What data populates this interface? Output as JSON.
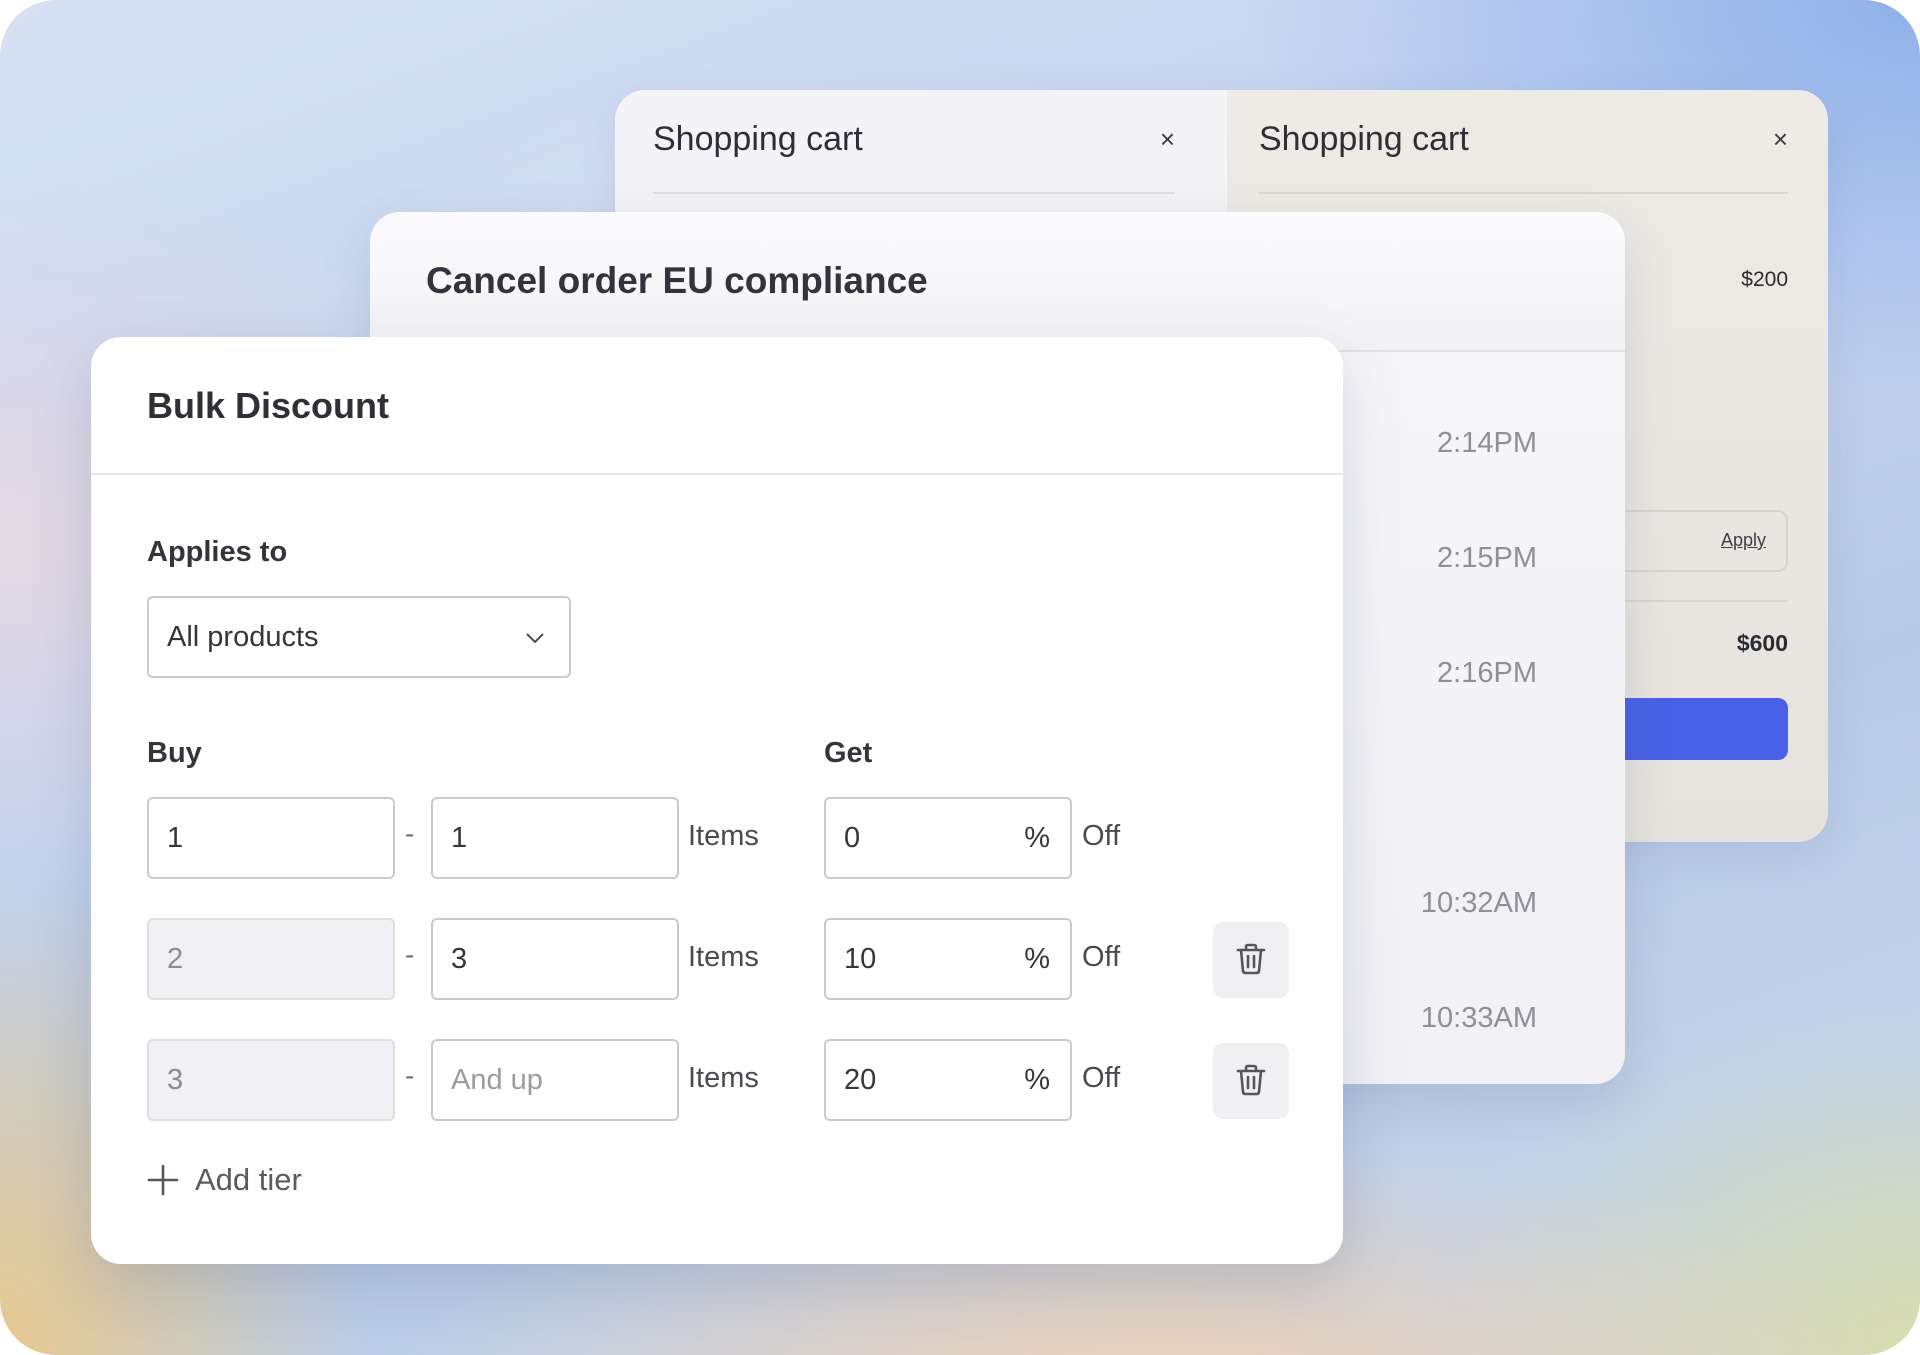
{
  "shopping_cart_left": {
    "title": "Shopping cart",
    "close_glyph": "×"
  },
  "shopping_cart_right": {
    "title": "Shopping cart",
    "close_glyph": "×",
    "line_price": "$200",
    "coupon_apply_label": "Apply",
    "total": "$600",
    "checkout_color": "#4a61e7"
  },
  "cancel_order": {
    "title": "Cancel order EU compliance",
    "timestamps": [
      "2:14PM",
      "2:15PM",
      "2:16PM",
      "10:32AM",
      "10:33AM"
    ]
  },
  "bulk_discount": {
    "title": "Bulk Discount",
    "applies_to_label": "Applies to",
    "applies_to_value": "All products",
    "buy_label": "Buy",
    "get_label": "Get",
    "dash": "-",
    "items_label": "Items",
    "percent_symbol": "%",
    "off_label": "Off",
    "tiers": [
      {
        "from": "1",
        "to": "1",
        "to_placeholder": "",
        "discount": "0",
        "deletable": false
      },
      {
        "from": "2",
        "to": "3",
        "to_placeholder": "",
        "discount": "10",
        "deletable": true
      },
      {
        "from": "3",
        "to": "",
        "to_placeholder": "And up",
        "discount": "20",
        "deletable": true
      }
    ],
    "add_tier_label": "Add tier",
    "icons": {
      "dropdown": "chevron-down-icon",
      "delete": "trash-icon",
      "add": "plus-icon"
    }
  }
}
